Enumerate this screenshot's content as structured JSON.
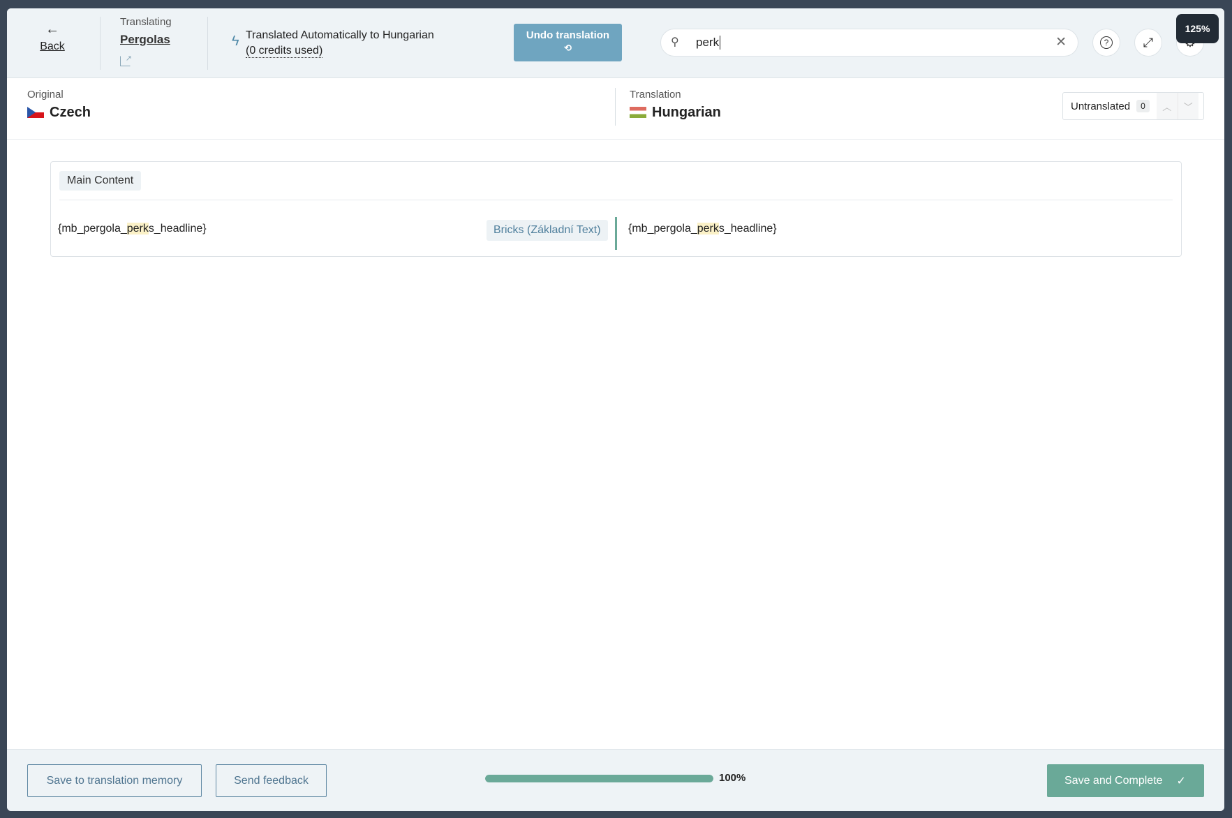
{
  "header": {
    "back_label": "Back",
    "translating_label": "Translating",
    "page_name": "Pergolas",
    "auto_line1": "Translated Automatically to Hungarian",
    "auto_line2": "(0 credits used)",
    "undo_label": "Undo translation",
    "search_value": "perk",
    "zoom_tooltip": "125%"
  },
  "languages": {
    "original_label": "Original",
    "original_name": "Czech",
    "translation_label": "Translation",
    "translation_name": "Hungarian",
    "filter_label": "Untranslated",
    "filter_count": "0"
  },
  "content": {
    "section_label": "Main Content",
    "rows": [
      {
        "source_pre": "{mb_pergola_",
        "source_hl": "perk",
        "source_post": "s_headline}",
        "type_tag": "Bricks (Základní Text)",
        "target_pre": "{mb_pergola_",
        "target_hl": "perk",
        "target_post": "s_headline}"
      }
    ]
  },
  "footer": {
    "save_tm_label": "Save to translation memory",
    "feedback_label": "Send feedback",
    "progress_percent": 100,
    "progress_label": "100%",
    "complete_label": "Save and Complete"
  },
  "colors": {
    "accent": "#6aa998",
    "undo": "#6fa5c0",
    "highlight": "#fbf1c7"
  }
}
